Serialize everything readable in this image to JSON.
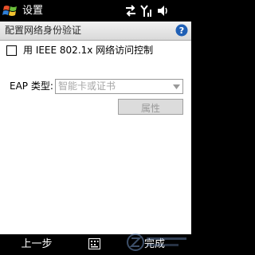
{
  "titlebar": {
    "title": "设置"
  },
  "header": {
    "text": "配置网络身份验证"
  },
  "checkbox": {
    "label": "用 IEEE 802.1x 网络访问控制",
    "checked": false
  },
  "eap": {
    "label": "EAP 类型:",
    "selected": "智能卡或证书"
  },
  "properties_button": {
    "label": "属性"
  },
  "softkeys": {
    "left": "上一步",
    "right": "完成"
  },
  "icons": {
    "start": "windows-flag-icon",
    "connectivity": "connectivity-arrows-icon",
    "signal": "signal-strength-icon",
    "volume": "speaker-vibrate-icon",
    "help": "help-icon",
    "sip": "keyboard-icon"
  },
  "colors": {
    "accent_blue": "#1f5fb5",
    "disabled_text": "#a6a6a6"
  }
}
